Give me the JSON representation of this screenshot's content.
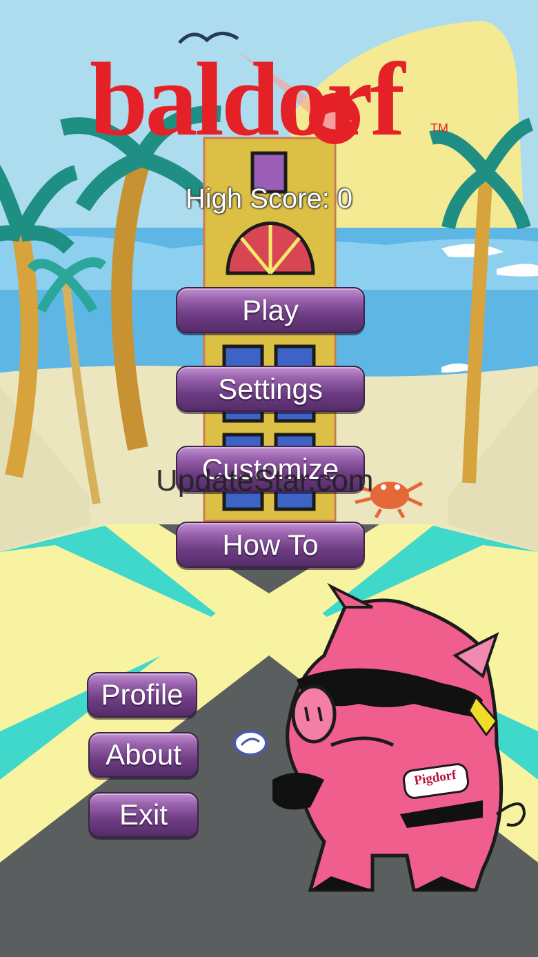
{
  "logo": {
    "text": "baldorf",
    "trademark": "TM"
  },
  "high_score": {
    "text": "High Score: 0"
  },
  "menu": {
    "play": "Play",
    "settings": "Settings",
    "customize": "Customize",
    "how_to": "How To",
    "profile": "Profile",
    "about": "About",
    "exit": "Exit"
  },
  "mascot": {
    "shirt_label": "Pigdorf"
  },
  "watermark": "UpdateStar.com",
  "colors": {
    "logo_red": "#e52128",
    "button_purple": "#7a4590",
    "sky": "#bfe3f0",
    "sand": "#efe9c4",
    "road": "#5a5e5f",
    "teal": "#3fd6c9",
    "yellow": "#f8f3a0",
    "pig_pink": "#ef5e8c"
  },
  "icons": [
    "bird-icon",
    "palm-tree-icon",
    "crab-icon",
    "pig-mascot-icon",
    "coin-icon",
    "building-icon"
  ]
}
